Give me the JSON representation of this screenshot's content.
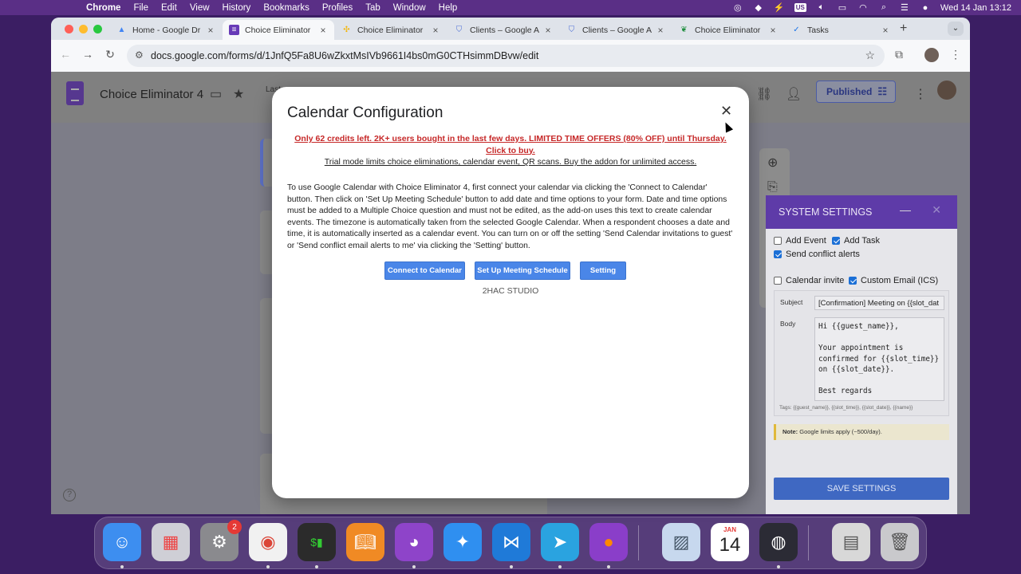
{
  "menubar": {
    "app": "Chrome",
    "items": [
      "File",
      "Edit",
      "View",
      "History",
      "Bookmarks",
      "Profiles",
      "Tab",
      "Window",
      "Help"
    ],
    "input_source": "US",
    "datetime": "Wed 14 Jan  13:12"
  },
  "browser": {
    "tabs": [
      {
        "label": "Home - Google Dr",
        "icon": "google-drive-icon",
        "color": "#4285f4"
      },
      {
        "label": "Choice Eliminator",
        "icon": "google-forms-icon",
        "color": "#673ab7"
      },
      {
        "label": "Choice Eliminator",
        "icon": "pinwheel-icon",
        "color": "#f4b400"
      },
      {
        "label": "Clients – Google A",
        "icon": "shield-icon",
        "color": "#4d6fd6"
      },
      {
        "label": "Clients – Google A",
        "icon": "shield-icon",
        "color": "#4d6fd6"
      },
      {
        "label": "Choice Eliminator",
        "icon": "leaf-icon",
        "color": "#1e8e3e"
      },
      {
        "label": "Tasks",
        "icon": "tasks-icon",
        "color": "#1a73e8"
      }
    ],
    "url": "docs.google.com/forms/d/1JnfQ5Fa8U6wZkxtMsIVb9661I4bs0mG0CTHsimmDBvw/edit"
  },
  "forms": {
    "title": "Choice Eliminator 4",
    "last_edit": "Last\nag",
    "published_label": "Published"
  },
  "modal": {
    "title": "Calendar Configuration",
    "promo": "Only 62 credits left. 2K+ users bought in the last few days. LIMITED TIME OFFERS (80% OFF) until Thursday. Click to buy.",
    "trial": "Trial mode limits choice eliminations, calendar event, QR scans. Buy the addon for unlimited access.",
    "description": "To use Google Calendar with Choice Eliminator 4, first connect your calendar via clicking the 'Connect to Calendar' button. Then click on 'Set Up Meeting Schedule' button to add date and time options to your form. Date and time options must be added to a Multiple Choice question and must not be edited, as the add-on uses this text to create calendar events. The timezone is automatically taken from the selected Google Calendar. When a respondent chooses a date and time, it is automatically inserted as a calendar event. You can turn on or off the setting 'Send Calendar invitations to guest' or 'Send conflict email alerts to me' via clicking the 'Setting' button.",
    "buttons": {
      "connect": "Connect to Calendar",
      "schedule": "Set Up Meeting Schedule",
      "setting": "Setting"
    },
    "studio": "2HAC STUDIO"
  },
  "settings": {
    "title": "SYSTEM SETTINGS",
    "add_event": {
      "label": "Add Event",
      "checked": false
    },
    "add_task": {
      "label": "Add Task",
      "checked": true
    },
    "send_conflict": {
      "label": "Send conflict alerts",
      "checked": true
    },
    "calendar_invite": {
      "label": "Calendar invite",
      "checked": false
    },
    "custom_email": {
      "label": "Custom Email (ICS)",
      "checked": true
    },
    "subject_label": "Subject",
    "subject_value": "[Confirmation] Meeting on {{slot_dat",
    "body_label": "Body",
    "body_value": "Hi {{guest_name}},\n\nYour appointment is confirmed for {{slot_time}} on {{slot_date}}.\n\nBest regards",
    "tags": "Tags: {{guest_name}}, {{slot_time}}, {{slot_date}}, {{name}}",
    "note_strong": "Note:",
    "note_text": " Google limits apply (~500/day).",
    "save_label": "SAVE SETTINGS"
  },
  "dock": {
    "apps": [
      {
        "name": "finder-icon",
        "color": "#3d8ef0"
      },
      {
        "name": "launchpad-icon",
        "color": "#cfcfd6"
      },
      {
        "name": "system-settings-icon",
        "color": "#8a8a8e",
        "badge": "2"
      },
      {
        "name": "chrome-icon",
        "color": "#f1f1f1"
      },
      {
        "name": "terminal-icon",
        "color": "#2b2b2b"
      },
      {
        "name": "books-icon",
        "color": "#f08a24"
      },
      {
        "name": "github-desktop-icon",
        "color": "#8e44c9"
      },
      {
        "name": "safari-icon",
        "color": "#2f8ff0"
      },
      {
        "name": "vscode-icon",
        "color": "#1f7ad8"
      },
      {
        "name": "telegram-icon",
        "color": "#2aa3e0"
      },
      {
        "name": "firefox-icon",
        "color": "#8a3ec9"
      },
      {
        "name": "preview-icon",
        "color": "#c7d8ee"
      },
      {
        "name": "calendar-icon",
        "color": "#ffffff",
        "month": "JAN",
        "day": "14"
      },
      {
        "name": "obs-icon",
        "color": "#2b2b35"
      },
      {
        "name": "documents-icon",
        "color": "#d8d8d8"
      },
      {
        "name": "trash-icon",
        "color": "#c9c9cc"
      }
    ]
  }
}
